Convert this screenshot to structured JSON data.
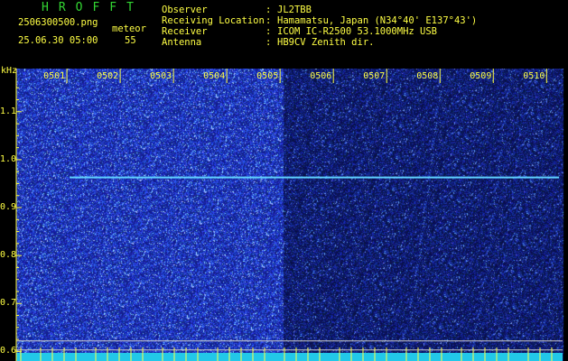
{
  "header": {
    "app_title": "HROFFT",
    "filename": "2506300500.png",
    "datetime": "25.06.30 05:00",
    "counter_label": "meteor",
    "counter_value": "55",
    "meta": [
      {
        "label": "Observer",
        "value": "JL2TBB"
      },
      {
        "label": "Receiving Location",
        "value": "Hamamatsu, Japan (N34°40' E137°43')"
      },
      {
        "label": "Receiver",
        "value": "ICOM IC-R2500 53.1000MHz USB"
      },
      {
        "label": "Antenna",
        "value": "HB9CV Zenith dir."
      }
    ],
    "separator": ":"
  },
  "chart_data": {
    "type": "heatmap",
    "ylabel": "kHz",
    "y_ticks": [
      "1.1",
      "1.0",
      "0.9",
      "0.8",
      "0.7",
      "0.6"
    ],
    "y_tick_values": [
      1.1,
      1.0,
      0.9,
      0.8,
      0.7,
      0.6
    ],
    "ylim": [
      0.58,
      1.19
    ],
    "x_ticks": [
      "0501",
      "0502",
      "0503",
      "0504",
      "0505",
      "0506",
      "0507",
      "0508",
      "0509",
      "0510"
    ],
    "x_tick_values": [
      1,
      2,
      3,
      4,
      5,
      6,
      7,
      8,
      9,
      10
    ],
    "xlim": [
      0.05,
      10.3
    ],
    "carrier_khz": 0.963,
    "carrier_start_min": 1.05,
    "reference_lines_khz": [
      0.622,
      0.603
    ],
    "bright_noise_end_min": 5.05,
    "colors": {
      "background": "#04104a",
      "noise_bright": "#2a44d8",
      "noise_dim": "#1a2aa0",
      "carrier": "#5fd0ff",
      "tick": "#ffff44",
      "reference": "#c8c8c8",
      "bottom_band": "#22c8e8"
    }
  }
}
